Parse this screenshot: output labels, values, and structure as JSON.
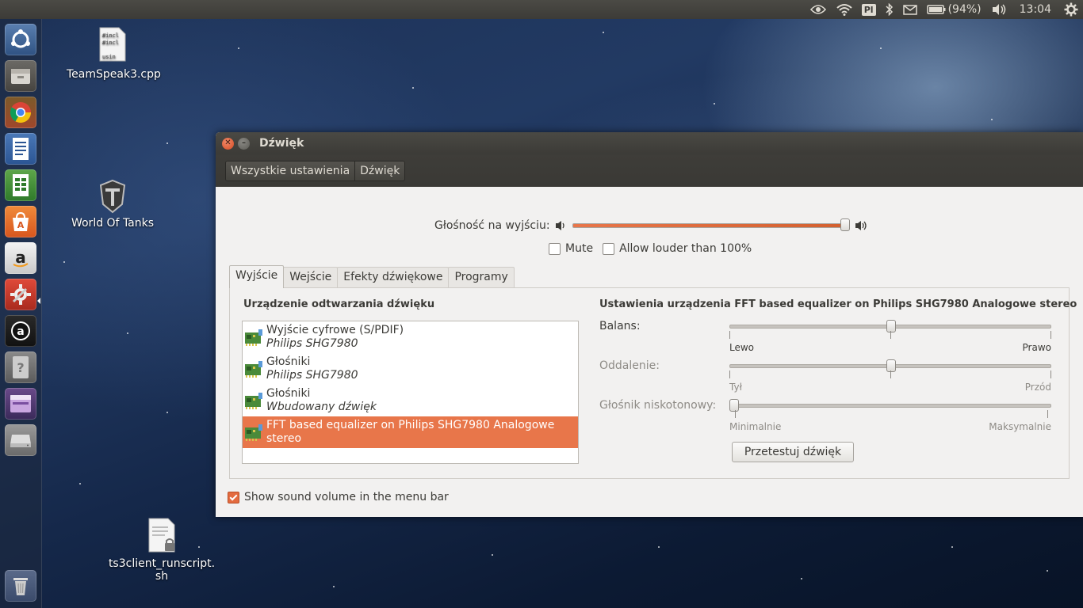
{
  "top_panel": {
    "keyboard_layout": "Pl",
    "battery": "(94%)",
    "clock": "13:04",
    "icons": [
      "nvidia-icon",
      "wifi-icon",
      "keyboard-layout-icon",
      "bluetooth-icon",
      "mail-icon",
      "battery-icon",
      "volume-icon",
      "gear-icon"
    ]
  },
  "launcher": {
    "items": [
      "dash-home",
      "files",
      "chrome",
      "libreoffice-writer",
      "libreoffice-calc",
      "ubuntu-software-center",
      "amazon",
      "system-settings",
      "audacious",
      "help",
      "workspace-switcher",
      "removable-drive",
      "trash"
    ]
  },
  "desktop": {
    "icons": [
      {
        "label": "TeamSpeak3.cpp"
      },
      {
        "label": "World Of Tanks"
      },
      {
        "label_line1": "ts3client_runscript.",
        "label_line2": "sh"
      }
    ]
  },
  "window": {
    "title": "Dźwięk",
    "breadcrumbs": [
      "Wszystkie ustawienia",
      "Dźwięk"
    ],
    "output_volume_label": "Głośność na wyjściu:",
    "output_volume": 0.98,
    "mute_label": "Mute",
    "mute_checked": false,
    "allow_louder_label": "Allow louder than 100%",
    "allow_louder_checked": false,
    "tabs": [
      "Wyjście",
      "Wejście",
      "Efekty dźwiękowe",
      "Programy"
    ],
    "active_tab": 0,
    "device_heading": "Urządzenie odtwarzania dźwięku",
    "devices": [
      {
        "name": "Wyjście cyfrowe (S/PDIF)",
        "sub": "Philips SHG7980",
        "selected": false
      },
      {
        "name": "Głośniki",
        "sub": "Philips SHG7980",
        "selected": false
      },
      {
        "name": "Głośniki",
        "sub": "Wbudowany dźwięk",
        "selected": false
      },
      {
        "name": "FFT based equalizer on Philips SHG7980 Analogowe stereo",
        "sub": "",
        "selected": true
      }
    ],
    "settings_heading": "Ustawienia urządzenia FFT based equalizer on Philips SHG7980 Analogowe stereo",
    "balance": {
      "label": "Balans:",
      "left": "Lewo",
      "right": "Prawo",
      "value": 0.5
    },
    "fade": {
      "label": "Oddalenie:",
      "left": "Tył",
      "right": "Przód",
      "value": 0.5
    },
    "subwoofer": {
      "label": "Głośnik niskotonowy:",
      "left": "Minimalnie",
      "right": "Maksymalnie",
      "value": 0.0
    },
    "test_button": "Przetestuj dźwięk",
    "show_volume_label": "Show sound volume in the menu bar",
    "show_volume_checked": true
  },
  "colors": {
    "accent": "#e8764a",
    "panel": "#3c3b37",
    "window_bg": "#f2f1f0"
  }
}
